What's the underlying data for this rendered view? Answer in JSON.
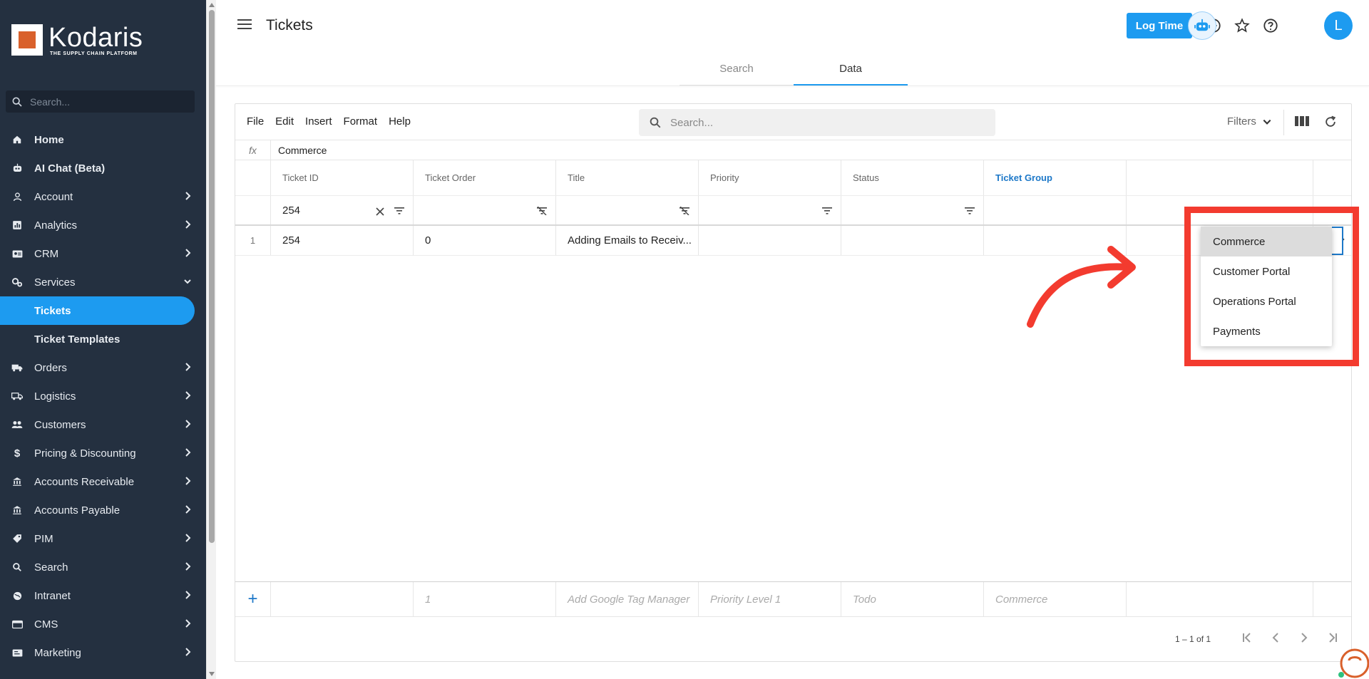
{
  "sidebar": {
    "logo_word": "Kodaris",
    "logo_tagline": "THE SUPPLY CHAIN PLATFORM",
    "search_placeholder": "Search...",
    "items": [
      {
        "label": "Home"
      },
      {
        "label": "AI Chat (Beta)"
      },
      {
        "label": "Account"
      },
      {
        "label": "Analytics"
      },
      {
        "label": "CRM"
      },
      {
        "label": "Services"
      },
      {
        "label": "Tickets"
      },
      {
        "label": "Ticket Templates"
      },
      {
        "label": "Orders"
      },
      {
        "label": "Logistics"
      },
      {
        "label": "Customers"
      },
      {
        "label": "Pricing & Discounting"
      },
      {
        "label": "Accounts Receivable"
      },
      {
        "label": "Accounts Payable"
      },
      {
        "label": "PIM"
      },
      {
        "label": "Search"
      },
      {
        "label": "Intranet"
      },
      {
        "label": "CMS"
      },
      {
        "label": "Marketing"
      }
    ]
  },
  "header": {
    "title": "Tickets",
    "log_time": "Log Time",
    "avatar_initial": "L",
    "tabs": [
      {
        "label": "Search"
      },
      {
        "label": "Data"
      }
    ]
  },
  "toolbar": {
    "menus": [
      "File",
      "Edit",
      "Insert",
      "Format",
      "Help"
    ],
    "search_placeholder": "Search...",
    "filters_label": "Filters"
  },
  "formula": {
    "fx": "fx",
    "value": "Commerce"
  },
  "grid": {
    "columns": [
      "Ticket ID",
      "Ticket Order",
      "Title",
      "Priority",
      "Status",
      "Ticket Group"
    ],
    "filter_values": {
      "ticket_id": "254"
    },
    "rows": [
      {
        "num": "1",
        "ticket_id": "254",
        "ticket_order": "0",
        "title": "Adding Emails to Receiv...",
        "priority": "",
        "status": "",
        "ticket_group": ""
      }
    ],
    "new_row": {
      "ticket_order": "1",
      "title": "Add Google Tag Manager",
      "priority": "Priority Level 1",
      "status": "Todo",
      "ticket_group": "Commerce"
    }
  },
  "dropdown": {
    "options": [
      "Commerce",
      "Customer Portal",
      "Operations Portal",
      "Payments"
    ],
    "selected": "Commerce"
  },
  "pager": {
    "text": "1 – 1 of 1"
  },
  "colors": {
    "sidebar_bg": "#243040",
    "accent": "#1d9bf0",
    "annotation_red": "#f33b2f"
  }
}
